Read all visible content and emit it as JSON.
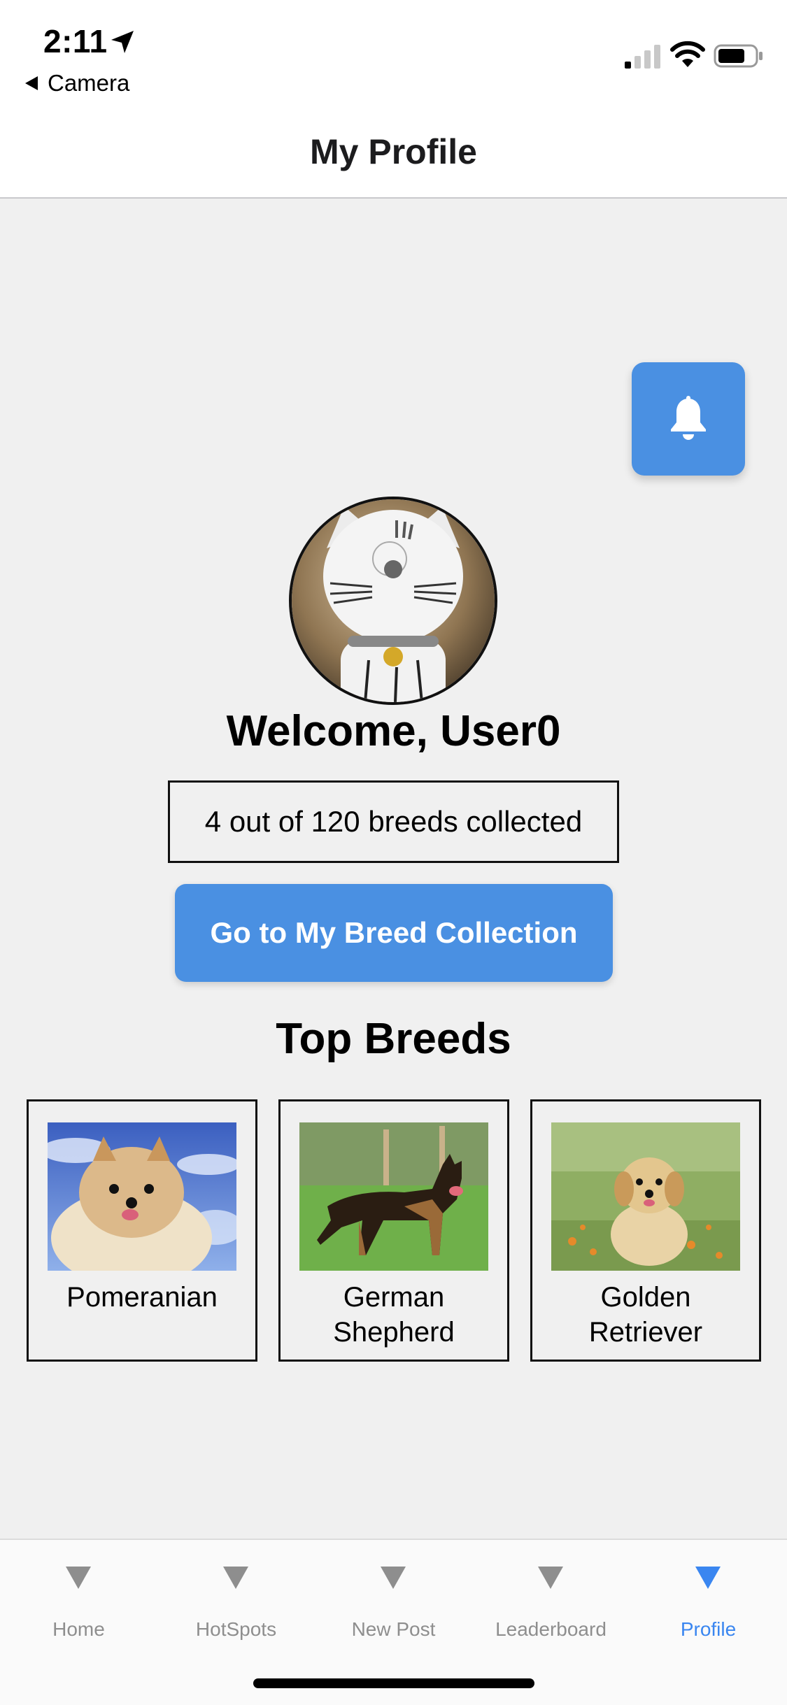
{
  "status_bar": {
    "time": "2:11",
    "back_label": "Camera"
  },
  "header": {
    "title": "My Profile"
  },
  "profile": {
    "welcome": "Welcome, User0",
    "progress_text": "4 out of 120 breeds collected",
    "collection_button": "Go to My Breed Collection",
    "top_breeds_title": "Top Breeds",
    "breeds": [
      {
        "name": "Pomeranian"
      },
      {
        "name": "German\nShepherd"
      },
      {
        "name": "Golden\nRetriever"
      }
    ]
  },
  "tabs": [
    {
      "label": "Home",
      "active": false
    },
    {
      "label": "HotSpots",
      "active": false
    },
    {
      "label": "New Post",
      "active": false
    },
    {
      "label": "Leaderboard",
      "active": false
    },
    {
      "label": "Profile",
      "active": true
    }
  ],
  "colors": {
    "accent": "#4a90e2",
    "tab_active": "#3a86f0",
    "tab_inactive": "#8e8e8e",
    "background": "#f0f0f0"
  },
  "icons": {
    "bell": "bell-icon",
    "location": "location-arrow-icon",
    "back": "back-triangle-icon"
  }
}
